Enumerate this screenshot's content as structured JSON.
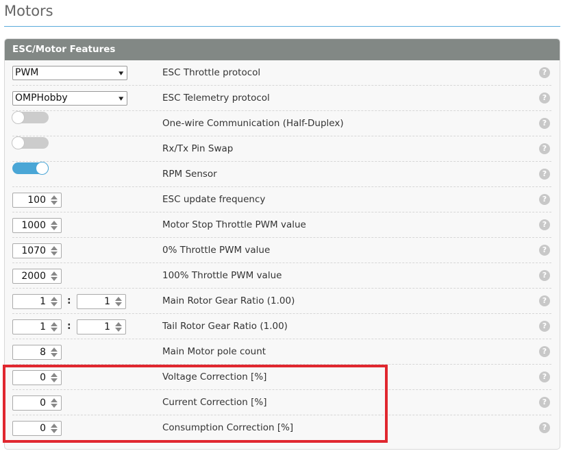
{
  "page": {
    "title": "Motors"
  },
  "panel": {
    "title": "ESC/Motor Features"
  },
  "help_glyph": "?",
  "rows": [
    {
      "type": "select",
      "value": "PWM",
      "label": "ESC Throttle protocol"
    },
    {
      "type": "select",
      "value": "OMPHobby",
      "label": "ESC Telemetry protocol"
    },
    {
      "type": "toggle",
      "on": false,
      "label": "One-wire Communication (Half-Duplex)"
    },
    {
      "type": "toggle",
      "on": false,
      "label": "Rx/Tx Pin Swap"
    },
    {
      "type": "toggle",
      "on": true,
      "label": "RPM Sensor"
    },
    {
      "type": "number",
      "value": "100",
      "label": "ESC update frequency"
    },
    {
      "type": "number",
      "value": "1000",
      "label": "Motor Stop Throttle PWM value"
    },
    {
      "type": "number",
      "value": "1070",
      "label": "0% Throttle PWM value"
    },
    {
      "type": "number",
      "value": "2000",
      "label": "100% Throttle PWM value"
    },
    {
      "type": "ratio",
      "left": "1",
      "right": "1",
      "separator": ":",
      "label": "Main Rotor Gear Ratio (1.00)"
    },
    {
      "type": "ratio",
      "left": "1",
      "right": "1",
      "separator": ":",
      "label": "Tail Rotor Gear Ratio (1.00)"
    },
    {
      "type": "number",
      "value": "8",
      "label": "Main Motor pole count"
    },
    {
      "type": "number",
      "value": "0",
      "label": "Voltage Correction [%]"
    },
    {
      "type": "number",
      "value": "0",
      "label": "Current Correction [%]"
    },
    {
      "type": "number",
      "value": "0",
      "label": "Consumption Correction [%]"
    }
  ],
  "colors": {
    "accent": "#4aa6d6",
    "header_bg": "#828885",
    "highlight": "#e0272f"
  }
}
